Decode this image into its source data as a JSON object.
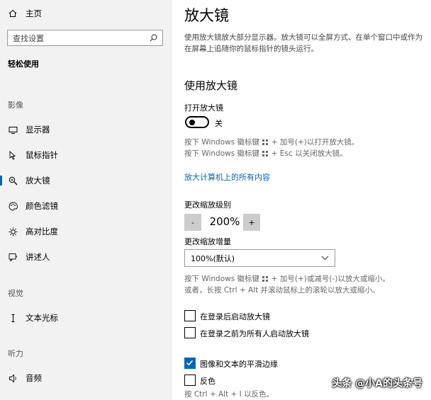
{
  "sidebar": {
    "home_label": "主页",
    "search_placeholder": "查找设置",
    "category": "轻松使用",
    "groups": {
      "vision": "影像",
      "hearing": "视觉",
      "interaction": "听力"
    },
    "items": [
      {
        "label": "显示器",
        "icon": "monitor-icon"
      },
      {
        "label": "鼠标指针",
        "icon": "mouse-pointer-icon"
      },
      {
        "label": "放大镜",
        "icon": "magnifier-icon",
        "active": true
      },
      {
        "label": "颜色滤镜",
        "icon": "palette-icon"
      },
      {
        "label": "高对比度",
        "icon": "contrast-icon"
      },
      {
        "label": "讲述人",
        "icon": "narrator-icon"
      },
      {
        "label": "文本光标",
        "icon": "text-cursor-icon"
      },
      {
        "label": "音频",
        "icon": "speaker-icon"
      }
    ]
  },
  "main": {
    "title": "放大镜",
    "description": "使用放大镜放大部分显示器。放大镜可以全屏方式、在单个窗口中或作为在屏幕上追随你的鼠标指针的镜头运行。",
    "section_title": "使用放大镜",
    "toggle_label": "打开放大镜",
    "toggle_state": "关",
    "hint_on_prefix": "按下 Windows 徽标键",
    "hint_on_suffix": "+ 加号(+)以打开放大镜。",
    "hint_off_prefix": "按下 Windows 徽标键",
    "hint_off_suffix": "+ Esc 以关闭放大镜。",
    "zoom_all_link": "放大计算机上的所有内容",
    "zoom_level_label": "更改缩放级别",
    "zoom_minus": "-",
    "zoom_value": "200%",
    "zoom_plus": "+",
    "increment_label": "更改缩放增量",
    "increment_value": "100%(默认)",
    "hint_zoom_line1_prefix": "按下 Windows 徽标键",
    "hint_zoom_line1_suffix": "+ 加号(+)或减号(-)以放大或缩小。",
    "hint_zoom_line2": "或者，长按 Ctrl + Alt 并滚动鼠标上的滚轮以放大或缩小。",
    "checkboxes": [
      {
        "label": "在登录后启动放大镜",
        "checked": false
      },
      {
        "label": "在登录之前为所有人启动放大镜",
        "checked": false
      },
      {
        "label": "图像和文本的平滑边缘",
        "checked": true
      },
      {
        "label": "反色",
        "checked": false
      }
    ],
    "invert_hint": "按 Ctrl + Alt + I 以反色。"
  },
  "watermark": "头条 @小A的头条号",
  "colors": {
    "accent": "#0067b8",
    "sidebar_bg": "#f2f2f2"
  }
}
